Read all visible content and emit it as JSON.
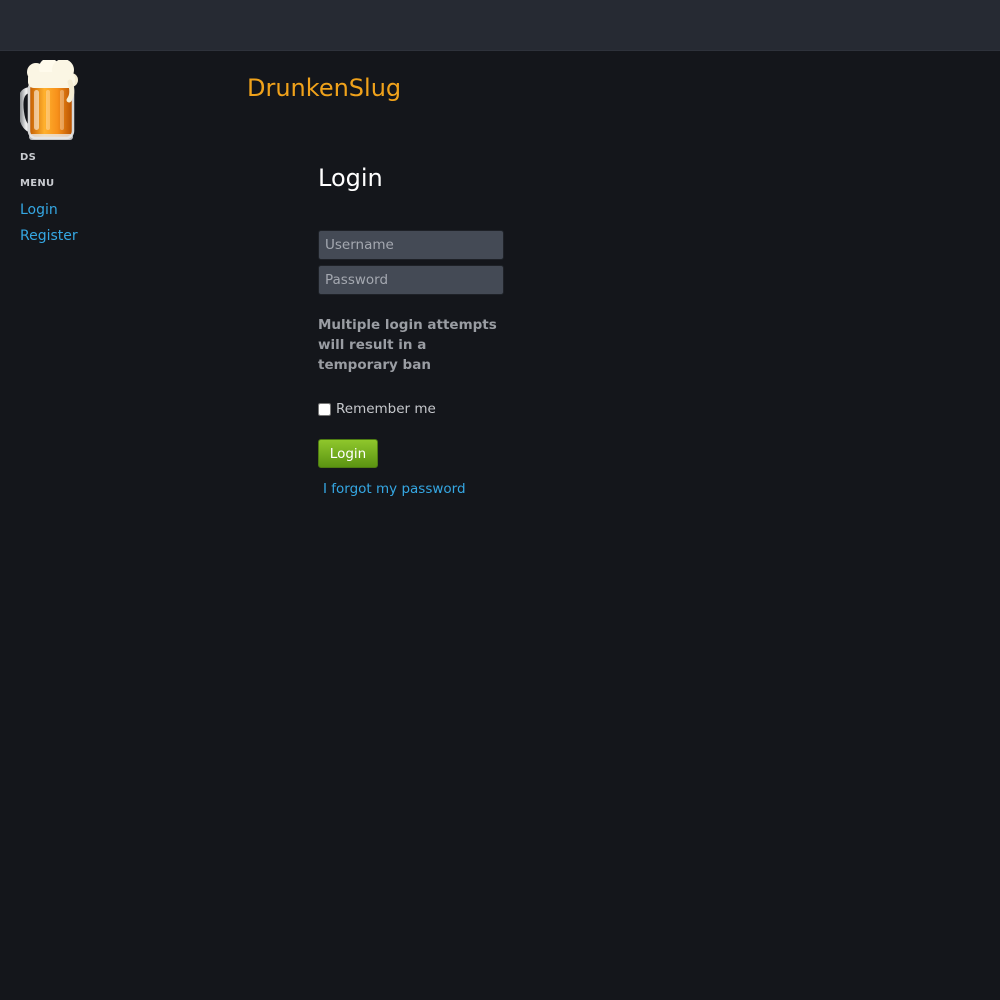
{
  "sidebar": {
    "logo_icon": "beer-mug-icon",
    "site_short": "DS",
    "menu_heading": "MENU",
    "links": {
      "login": "Login",
      "register": "Register"
    }
  },
  "header": {
    "site_title": "DrunkenSlug"
  },
  "login_form": {
    "title": "Login",
    "username_placeholder": "Username",
    "password_placeholder": "Password",
    "warning": "Multiple login attempts will result in a temporary ban",
    "remember_label": "Remember me",
    "remember_checked": false,
    "submit_label": "Login",
    "forgot_link": "I forgot my password"
  },
  "colors": {
    "background": "#14161b",
    "topbar": "#262a33",
    "brand": "#f0a21b",
    "link": "#35a7e3",
    "button": "#6fa91b"
  }
}
